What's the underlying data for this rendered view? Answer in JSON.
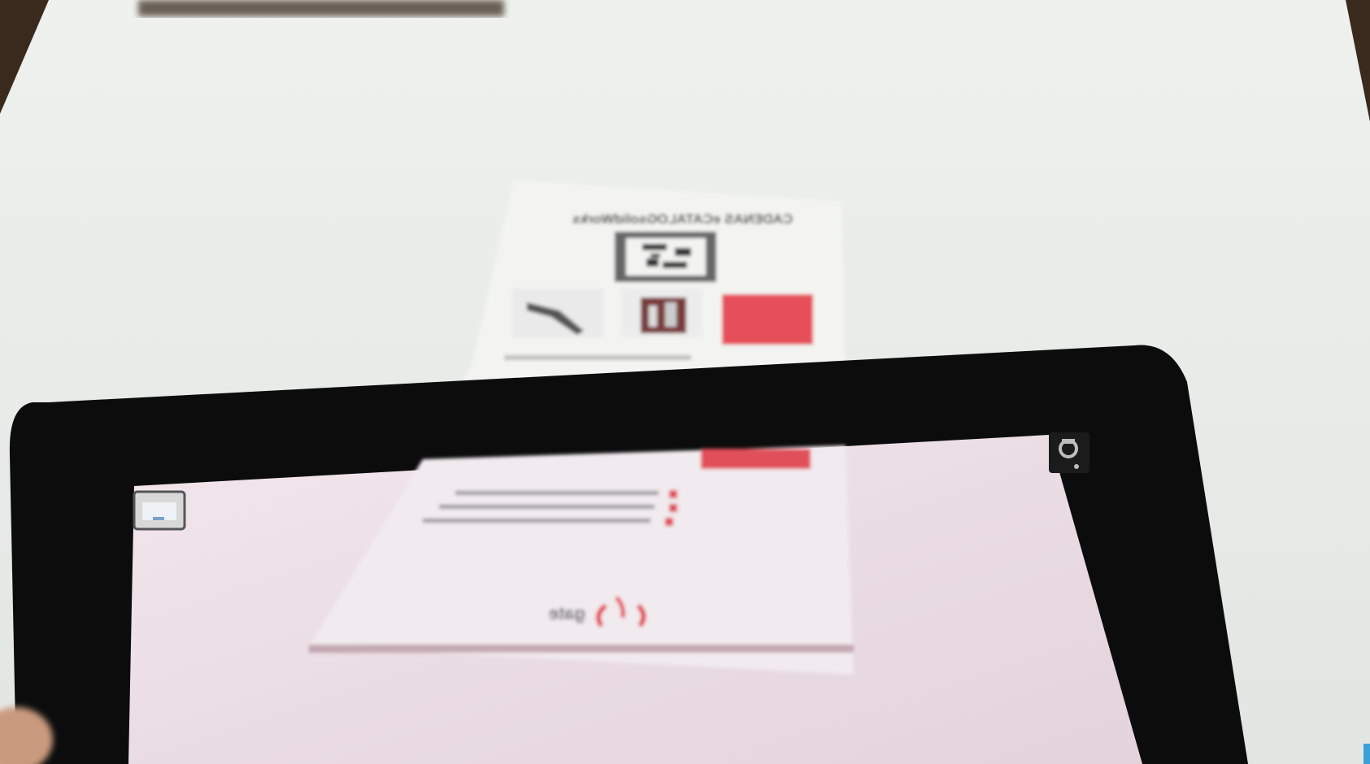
{
  "scene": {
    "description_free": true,
    "brochure_title": "CADENAS eCATALOGsolidWorks",
    "brochure_logo_text": "gate",
    "accent_color": "#e23b46",
    "tablet_bezel_color": "#0c0c0c",
    "table_color": "#e7ebe6"
  },
  "icons": {
    "tablet_corner_button": "camera-icon",
    "tablet_left_widget": "thumbnail-icon"
  }
}
